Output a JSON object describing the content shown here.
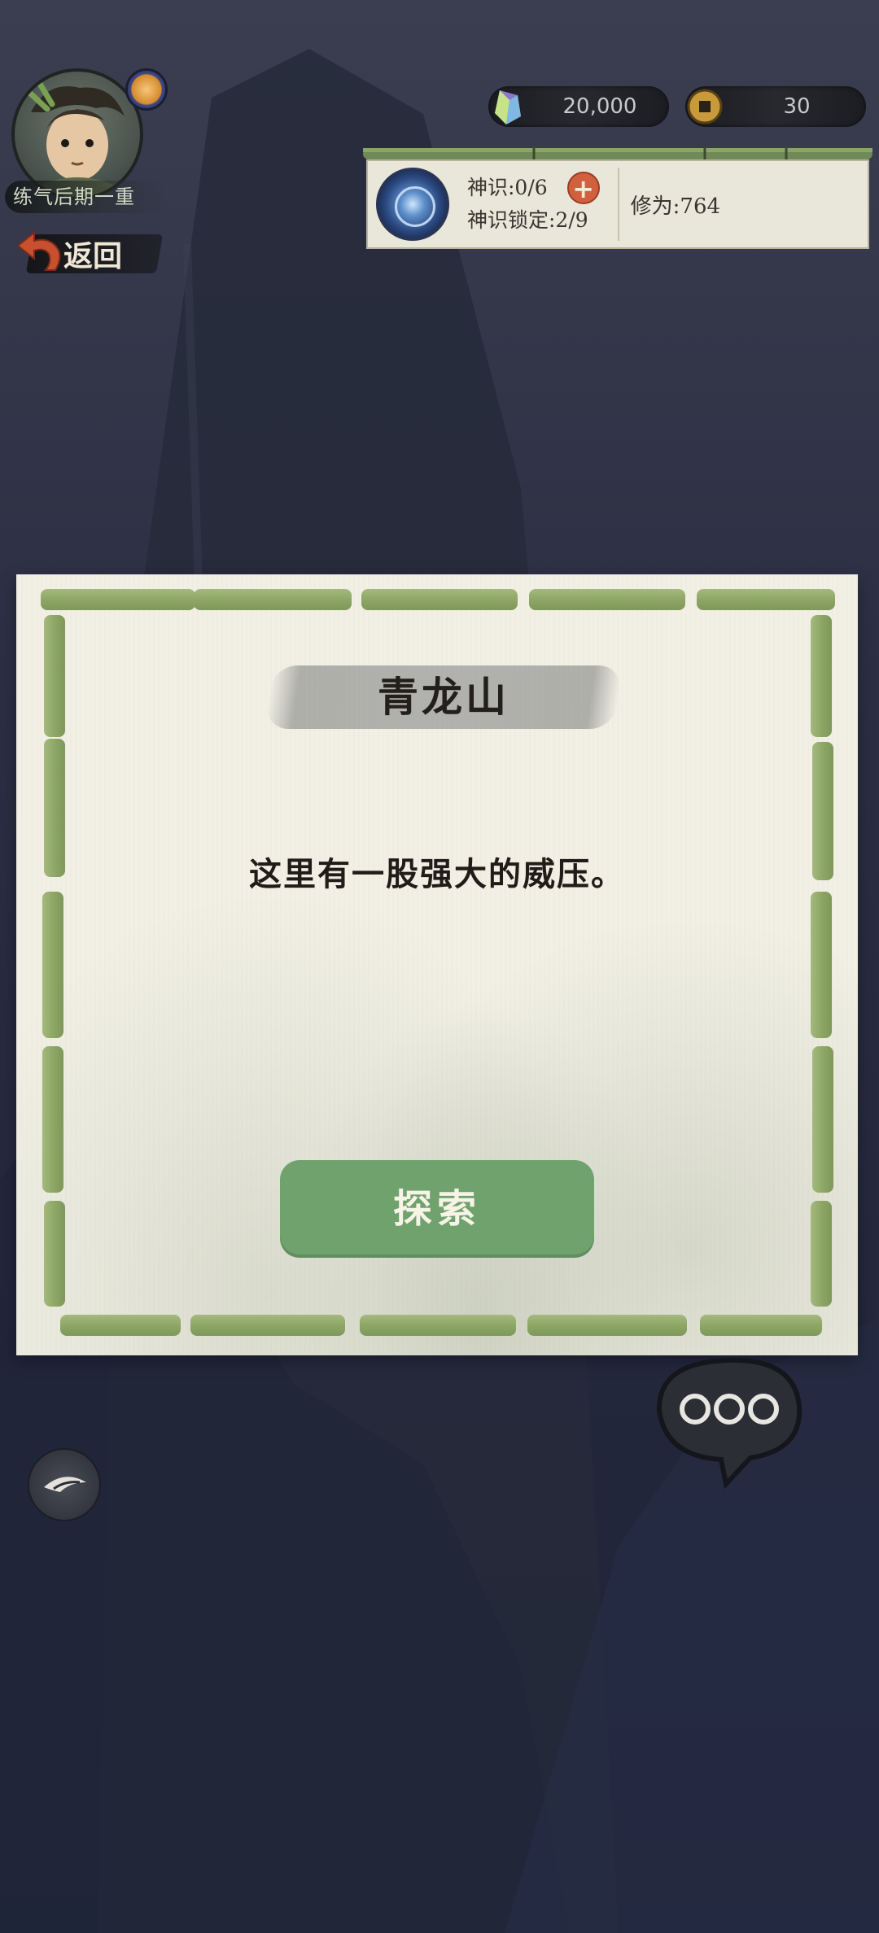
{
  "player": {
    "realm": "练气后期一重",
    "back_label": "返回"
  },
  "currency": {
    "spirit_stones": "20,000",
    "coins": "30"
  },
  "status": {
    "divine_sense": "神识:0/6",
    "sense_lock": "神识锁定:2/9",
    "cultivation": "修为:764",
    "plus_label": "+"
  },
  "dialog": {
    "title": "青龙山",
    "message": "这里有一股强大的威压。",
    "explore_label": "探索"
  },
  "icons": {
    "avatar": "cultivator-portrait",
    "badge": "realm-badge-icon",
    "back": "back-arrow-icon",
    "gem": "spirit-stone-icon",
    "coin": "copper-coin-icon",
    "orb": "divine-sense-orb-icon",
    "eye": "eye-icon",
    "chat": "chat-bubble-icon"
  },
  "colors": {
    "background": "#2c2f43",
    "paper": "#f2f0e5",
    "bamboo": "#8ea766",
    "explore_button": "#6fa26d",
    "plus_button": "#d0603e"
  }
}
